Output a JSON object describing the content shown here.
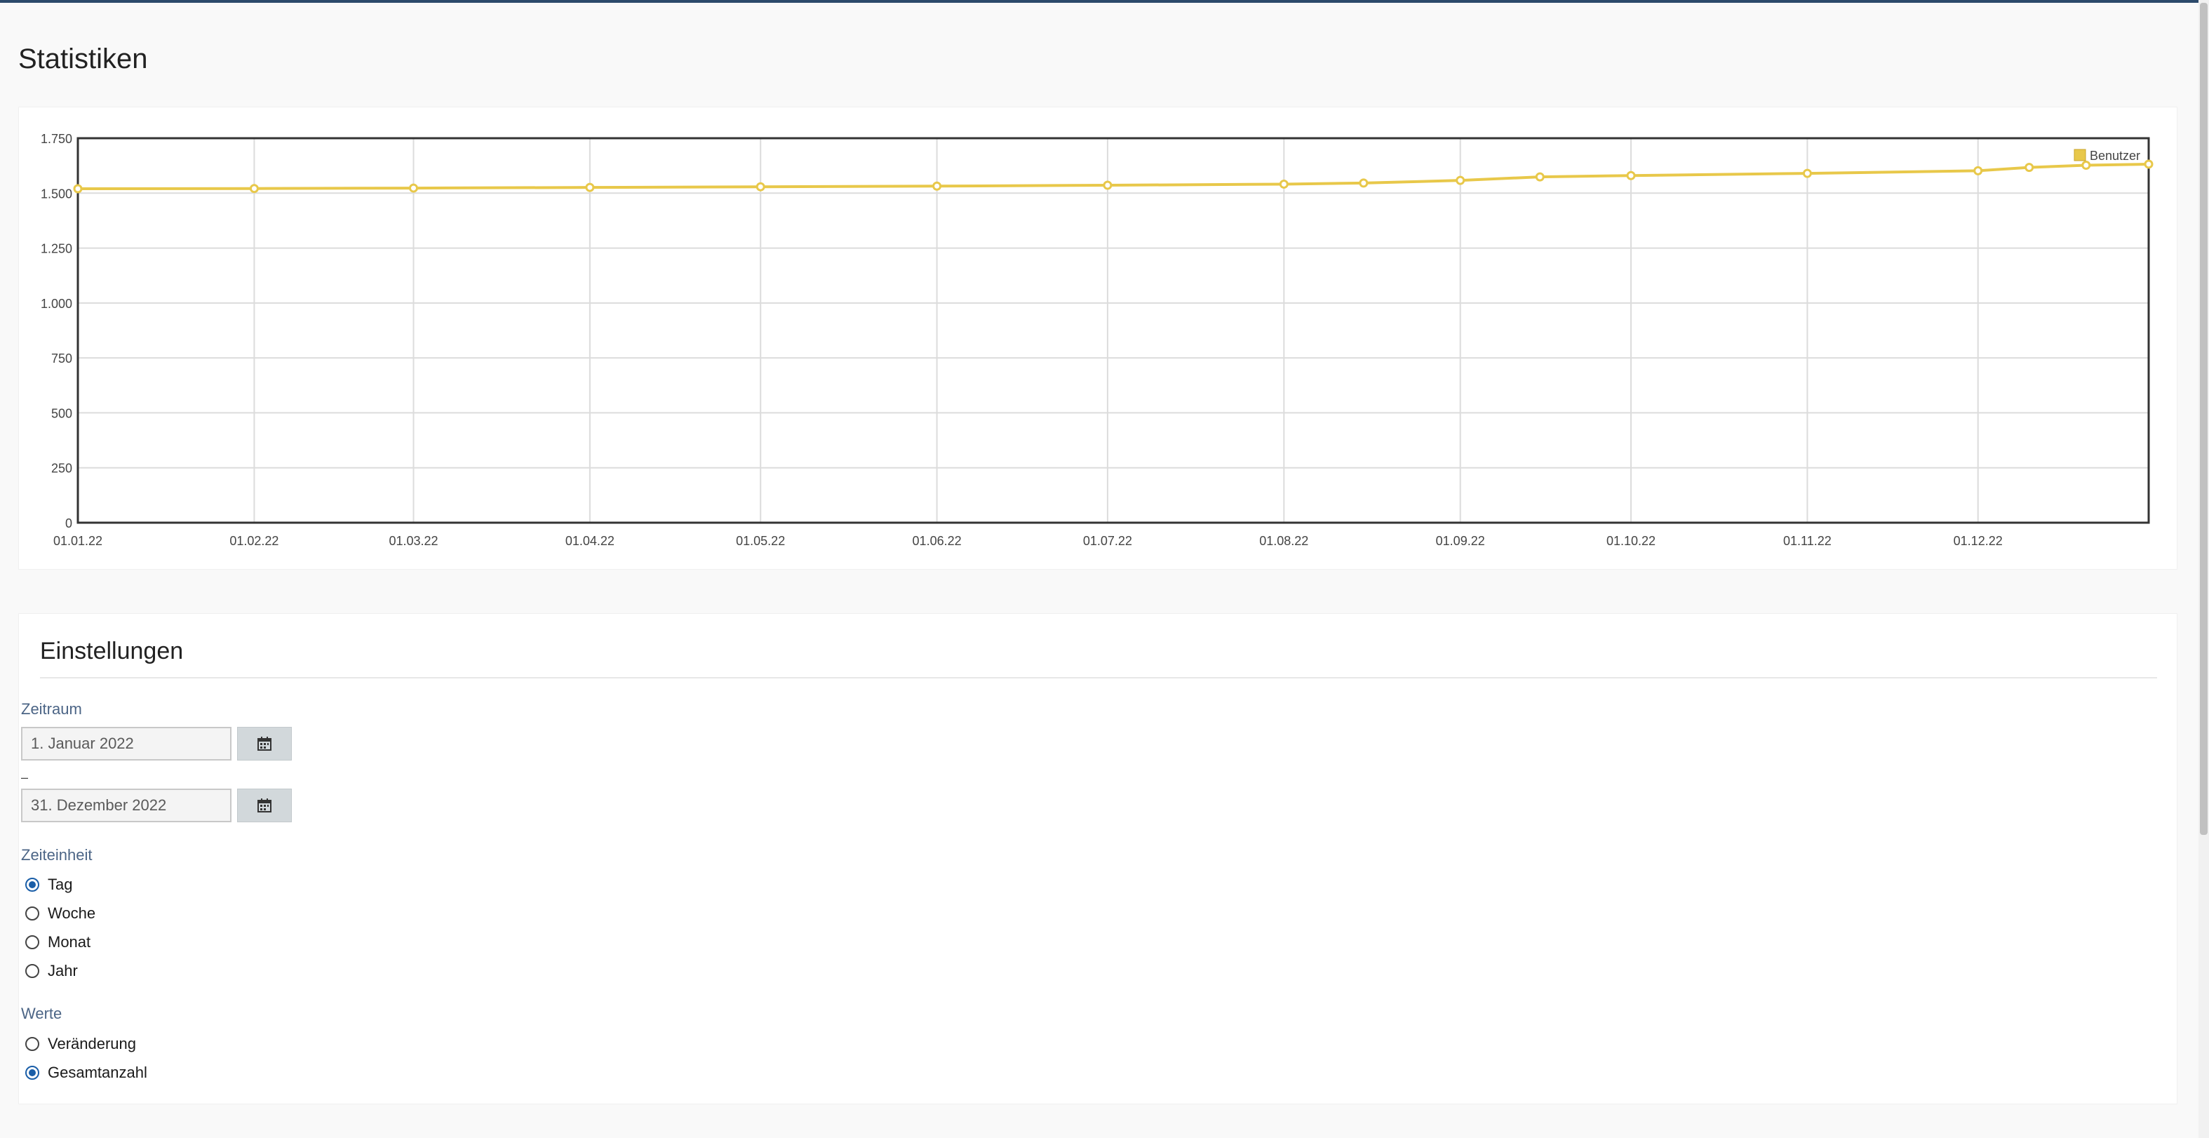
{
  "page": {
    "title": "Statistiken"
  },
  "chart_data": {
    "type": "line",
    "x_ticks": [
      "01.01.22",
      "01.02.22",
      "01.03.22",
      "01.04.22",
      "01.05.22",
      "01.06.22",
      "01.07.22",
      "01.08.22",
      "01.09.22",
      "01.10.22",
      "01.11.22",
      "01.12.22"
    ],
    "y_ticks": [
      "0",
      "250",
      "500",
      "750",
      "1.000",
      "1.250",
      "1.500",
      "1.750"
    ],
    "ylim": [
      0,
      1750
    ],
    "xlim": [
      "2022-01-01",
      "2022-12-31"
    ],
    "grid": true,
    "legend": "top-right",
    "series": [
      {
        "name": "Benutzer",
        "color": "#e8c84a",
        "x": [
          "2022-01-01",
          "2022-02-01",
          "2022-03-01",
          "2022-04-01",
          "2022-05-01",
          "2022-06-01",
          "2022-07-01",
          "2022-08-01",
          "2022-08-15",
          "2022-09-01",
          "2022-09-15",
          "2022-10-01",
          "2022-11-01",
          "2022-12-01",
          "2022-12-10",
          "2022-12-20",
          "2022-12-31"
        ],
        "values": [
          1520,
          1521,
          1523,
          1526,
          1529,
          1532,
          1536,
          1541,
          1546,
          1558,
          1574,
          1580,
          1590,
          1602,
          1617,
          1627,
          1632
        ]
      }
    ]
  },
  "settings": {
    "title": "Einstellungen",
    "period_label": "Zeitraum",
    "date_from": "1. Januar 2022",
    "date_to": "31. Dezember 2022",
    "range_separator": "–",
    "unit_label": "Zeiteinheit",
    "units": [
      "Tag",
      "Woche",
      "Monat",
      "Jahr"
    ],
    "unit_selected": "Tag",
    "values_label": "Werte",
    "value_options": [
      "Veränderung",
      "Gesamtanzahl"
    ],
    "value_selected": "Gesamtanzahl"
  }
}
